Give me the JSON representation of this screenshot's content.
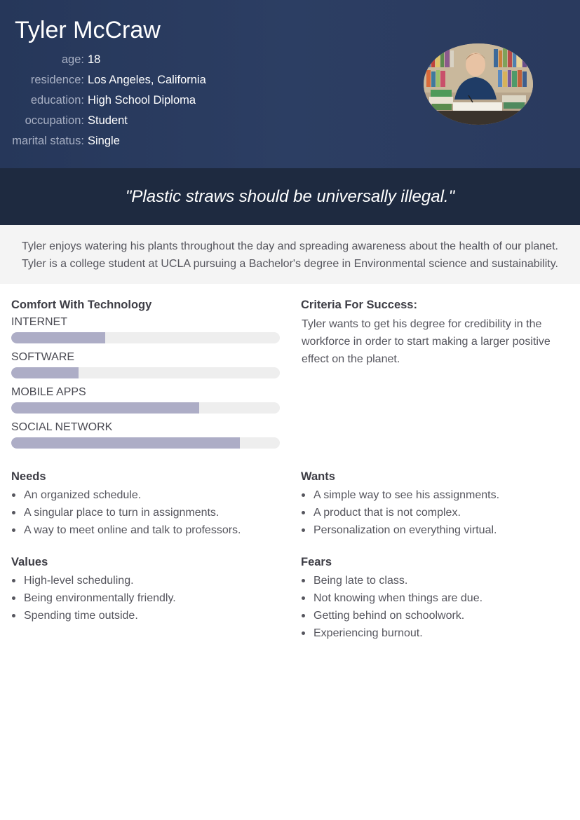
{
  "persona": {
    "name": "Tyler McCraw",
    "facts": [
      {
        "label": "age:",
        "value": "18"
      },
      {
        "label": "residence:",
        "value": "Los Angeles, California"
      },
      {
        "label": "education:",
        "value": "High School Diploma"
      },
      {
        "label": "occupation:",
        "value": "Student"
      },
      {
        "label": "marital status:",
        "value": "Single"
      }
    ],
    "quote": "\"Plastic straws should be universally illegal.\"",
    "bio": [
      "Tyler enjoys watering his plants throughout the day and spreading awareness about the health of our planet.",
      "Tyler is a college student at UCLA pursuing a Bachelor's degree in Environmental science and sustainability."
    ]
  },
  "technology": {
    "title": "Comfort With Technology",
    "skills": [
      {
        "label": "INTERNET",
        "level": 0.35
      },
      {
        "label": "SOFTWARE",
        "level": 0.25
      },
      {
        "label": "MOBILE APPS",
        "level": 0.7
      },
      {
        "label": "SOCIAL NETWORK",
        "level": 0.85
      }
    ]
  },
  "criteria": {
    "title": "Criteria For Success:",
    "text": "Tyler wants to get his degree for credibility in the workforce in order to start making a larger positive effect on the planet."
  },
  "needs": {
    "title": "Needs",
    "items": [
      "An organized schedule.",
      "A singular place to turn in assignments.",
      "A way to meet online and talk to professors."
    ]
  },
  "wants": {
    "title": "Wants",
    "items": [
      "A simple way to see his assignments.",
      "A product that is not complex.",
      "Personalization on everything virtual."
    ]
  },
  "values": {
    "title": "Values",
    "items": [
      "High-level scheduling.",
      "Being environmentally friendly.",
      "Spending time outside."
    ]
  },
  "fears": {
    "title": "Fears",
    "items": [
      "Being late to class.",
      "Not knowing when things are due.",
      "Getting behind on schoolwork.",
      "Experiencing burnout."
    ]
  }
}
